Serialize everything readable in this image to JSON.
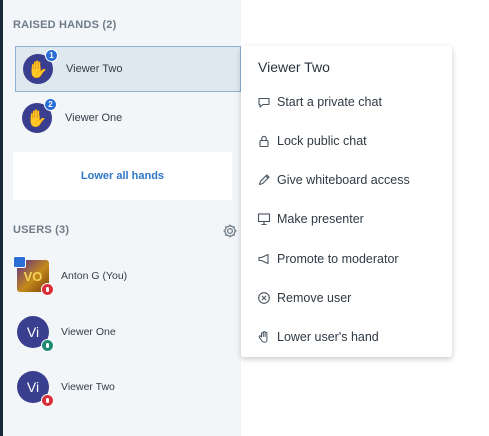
{
  "raised_hands": {
    "title": "RAISED HANDS (2)",
    "items": [
      {
        "name": "Viewer Two",
        "order": "1",
        "icon": "raised-hand-icon"
      },
      {
        "name": "Viewer One",
        "order": "2",
        "icon": "raised-hand-icon"
      }
    ],
    "lower_all_label": "Lower all hands"
  },
  "users": {
    "title": "USERS (3)",
    "settings_icon": "gear-icon",
    "items": [
      {
        "name": "Anton G (You)",
        "initials": "VO",
        "status": "muted",
        "presenter": true
      },
      {
        "name": "Viewer One",
        "initials": "Vi",
        "status": "live",
        "presenter": false
      },
      {
        "name": "Viewer Two",
        "initials": "Vi",
        "status": "muted",
        "presenter": false
      }
    ]
  },
  "context_menu": {
    "title": "Viewer Two",
    "items": [
      {
        "label": "Start a private chat",
        "icon": "chat-icon"
      },
      {
        "label": "Lock public chat",
        "icon": "lock-icon"
      },
      {
        "label": "Give whiteboard access",
        "icon": "pen-icon"
      },
      {
        "label": "Make presenter",
        "icon": "presentation-icon"
      },
      {
        "label": "Promote to moderator",
        "icon": "megaphone-icon"
      },
      {
        "label": "Remove user",
        "icon": "remove-icon"
      },
      {
        "label": "Lower user's hand",
        "icon": "hand-icon"
      }
    ]
  },
  "colors": {
    "accent": "#2e76c6",
    "avatar": "#3a3e8f",
    "muted": "#d8303a",
    "live": "#1f8a72"
  }
}
